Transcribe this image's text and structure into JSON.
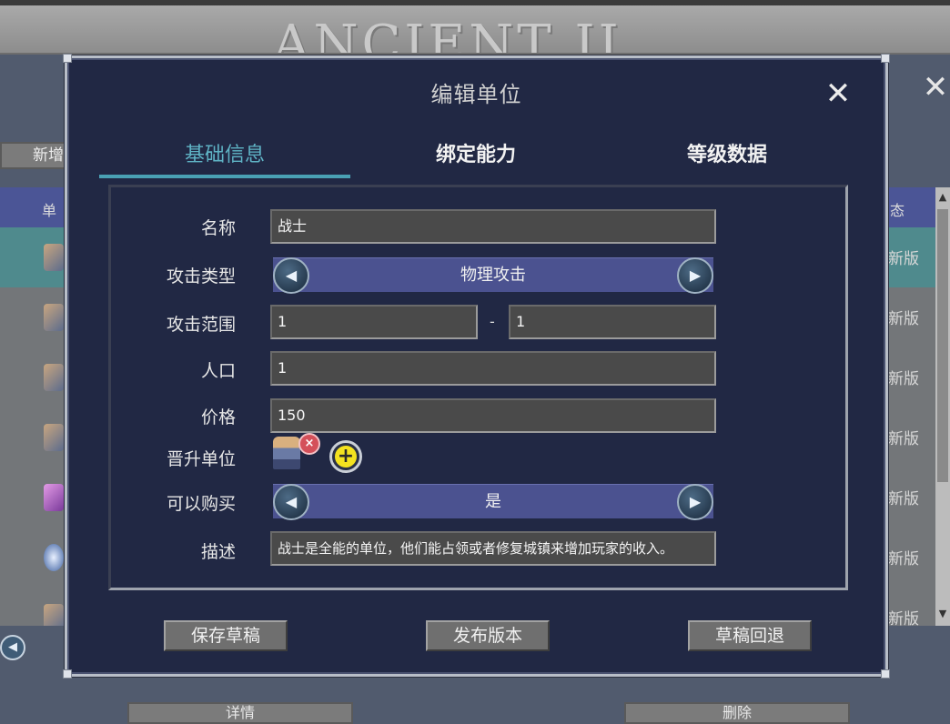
{
  "background": {
    "logo_text": "ANCIENT II",
    "new_button": "新增",
    "table_header_first": "单",
    "table_header_last": "态",
    "rows": [
      {
        "status": "新版",
        "selected": true
      },
      {
        "status": "新版",
        "selected": false
      },
      {
        "status": "新版",
        "selected": false
      },
      {
        "status": "新版",
        "selected": false
      },
      {
        "status": "新版",
        "selected": false
      },
      {
        "status": "新版",
        "selected": false
      },
      {
        "status": "新版",
        "selected": false
      }
    ],
    "detail_button": "详情",
    "delete_button": "删除"
  },
  "modal": {
    "title": "编辑单位",
    "tabs": [
      {
        "label": "基础信息",
        "active": true
      },
      {
        "label": "绑定能力",
        "active": false
      },
      {
        "label": "等级数据",
        "active": false
      }
    ],
    "fields": {
      "name": {
        "label": "名称",
        "value": "战士"
      },
      "attack_type": {
        "label": "攻击类型",
        "value": "物理攻击"
      },
      "attack_range": {
        "label": "攻击范围",
        "min": "1",
        "separator": "-",
        "max": "1"
      },
      "population": {
        "label": "人口",
        "value": "1"
      },
      "price": {
        "label": "价格",
        "value": "150"
      },
      "promotion": {
        "label": "晋升单位"
      },
      "purchasable": {
        "label": "可以购买",
        "value": "是"
      },
      "description": {
        "label": "描述",
        "value": "战士是全能的单位，他们能占领或者修复城镇来增加玩家的收入。"
      }
    },
    "buttons": {
      "save_draft": "保存草稿",
      "publish": "发布版本",
      "rollback": "草稿回退"
    }
  },
  "colors": {
    "modal_bg": "#212844",
    "tab_active": "#5fb3c5",
    "selector_bg": "#4b5290",
    "row_selected": "#4f8a8d"
  }
}
